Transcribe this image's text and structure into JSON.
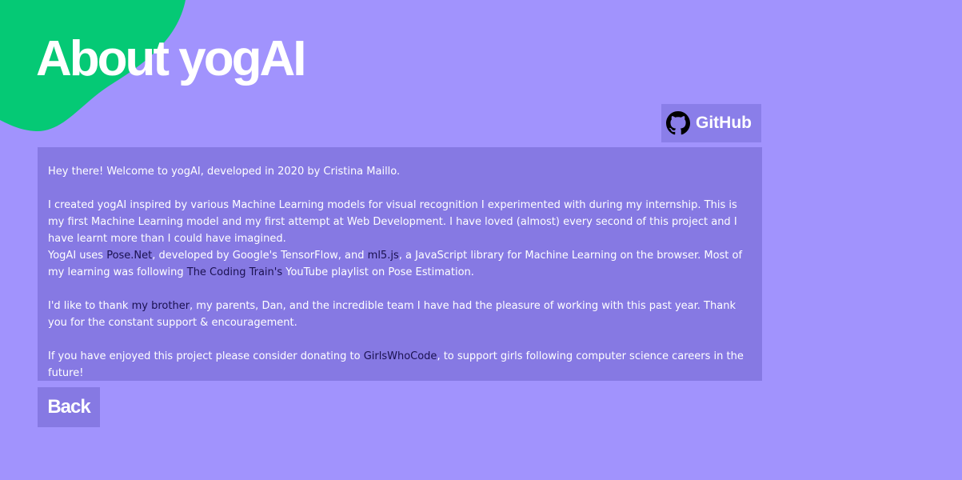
{
  "colors": {
    "background": "#a193fd",
    "blob": "#05c975",
    "panel": "#8679e3",
    "button": "#8a7ee9",
    "link": "#1a1150",
    "text": "#ffffff"
  },
  "header": {
    "title": "About yogAI"
  },
  "github": {
    "label": "GitHub",
    "icon": "github-icon"
  },
  "content": {
    "intro": "Hey there! Welcome to yogAI, developed in 2020 by Cristina Maillo.",
    "p2_text": "I created yogAI inspired by various Machine Learning models for visual recognition I experimented with during my internship. This is my first Machine Learning model and my first attempt at Web Development. I have loved (almost) every second of this project and I have learnt more than I could have imagined.",
    "p3_a": "YogAI uses ",
    "link_posenet": "Pose.Net",
    "p3_b": ", developed by Google's TensorFlow, and ",
    "link_ml5": "ml5.js",
    "p3_c": ", a JavaScript library for Machine Learning on the browser. Most of my learning was following ",
    "link_coding_train": "The Coding Train's",
    "p3_d": " YouTube playlist on Pose Estimation.",
    "p4_a": "I'd like to thank ",
    "link_brother": "my brother",
    "p4_b": ", my parents, Dan, and the incredible team I have had the pleasure of working with this past year. Thank you for the constant support & encouragement.",
    "p5_a": "If you have enjoyed this project please consider donating to ",
    "link_gwc": "GirlsWhoCode",
    "p5_b": ", to support girls following computer science careers in the future!"
  },
  "back": {
    "label": "Back"
  }
}
